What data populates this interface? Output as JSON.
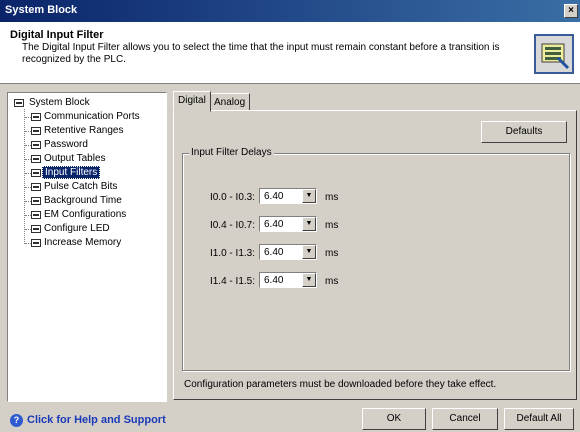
{
  "window": {
    "title": "System Block",
    "close": "×"
  },
  "header": {
    "title": "Digital Input Filter",
    "description": "The Digital Input Filter allows you to select the time that the input must remain constant before a transition is recognized by the PLC."
  },
  "tree": {
    "root": "System Block",
    "items": [
      {
        "label": "Communication Ports"
      },
      {
        "label": "Retentive Ranges"
      },
      {
        "label": "Password"
      },
      {
        "label": "Output Tables"
      },
      {
        "label": "Input Filters"
      },
      {
        "label": "Pulse Catch Bits"
      },
      {
        "label": "Background Time"
      },
      {
        "label": "EM Configurations"
      },
      {
        "label": "Configure LED"
      },
      {
        "label": "Increase Memory"
      }
    ]
  },
  "tabs": [
    "Digital",
    "Analog"
  ],
  "panel": {
    "defaults_label": "Defaults",
    "group_title": "Input Filter Delays",
    "filters": [
      {
        "label": "I0.0 - I0.3:",
        "value": "6.40",
        "unit": "ms"
      },
      {
        "label": "I0.4 - I0.7:",
        "value": "6.40",
        "unit": "ms"
      },
      {
        "label": "I1.0 - I1.3:",
        "value": "6.40",
        "unit": "ms"
      },
      {
        "label": "I1.4 - I1.5:",
        "value": "6.40",
        "unit": "ms"
      }
    ],
    "note": "Configuration parameters must be downloaded before they take effect."
  },
  "footer": {
    "help": "Click for Help and Support",
    "help_glyph": "?",
    "ok": "OK",
    "cancel": "Cancel",
    "default_all": "Default All"
  }
}
